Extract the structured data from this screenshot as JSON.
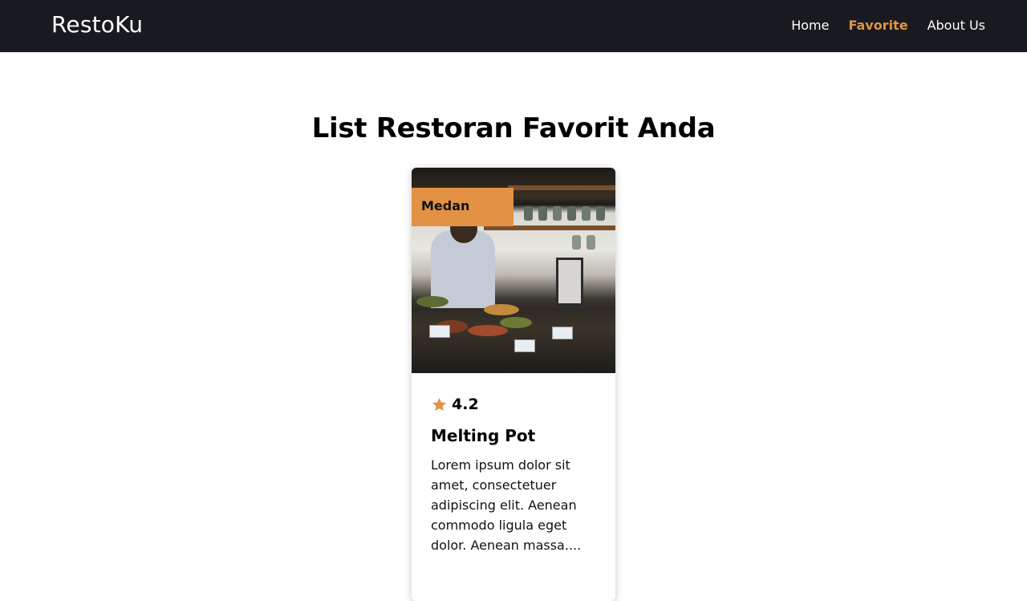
{
  "app": {
    "brand": "RestoKu"
  },
  "nav": {
    "items": [
      {
        "label": "Home",
        "active": false
      },
      {
        "label": "Favorite",
        "active": true
      },
      {
        "label": "About Us",
        "active": false
      }
    ]
  },
  "main": {
    "title": "List Restoran Favorit Anda"
  },
  "restaurants": [
    {
      "city": "Medan",
      "rating": "4.2",
      "name": "Melting Pot",
      "description": "Lorem ipsum dolor sit amet, consectetuer adipiscing elit. Aenean commodo ligula eget dolor. Aenean massa...."
    }
  ],
  "colors": {
    "navbar_bg": "#191a1f",
    "accent": "#e39245",
    "text": "#000000"
  },
  "icons": {
    "rating": "star-icon"
  }
}
